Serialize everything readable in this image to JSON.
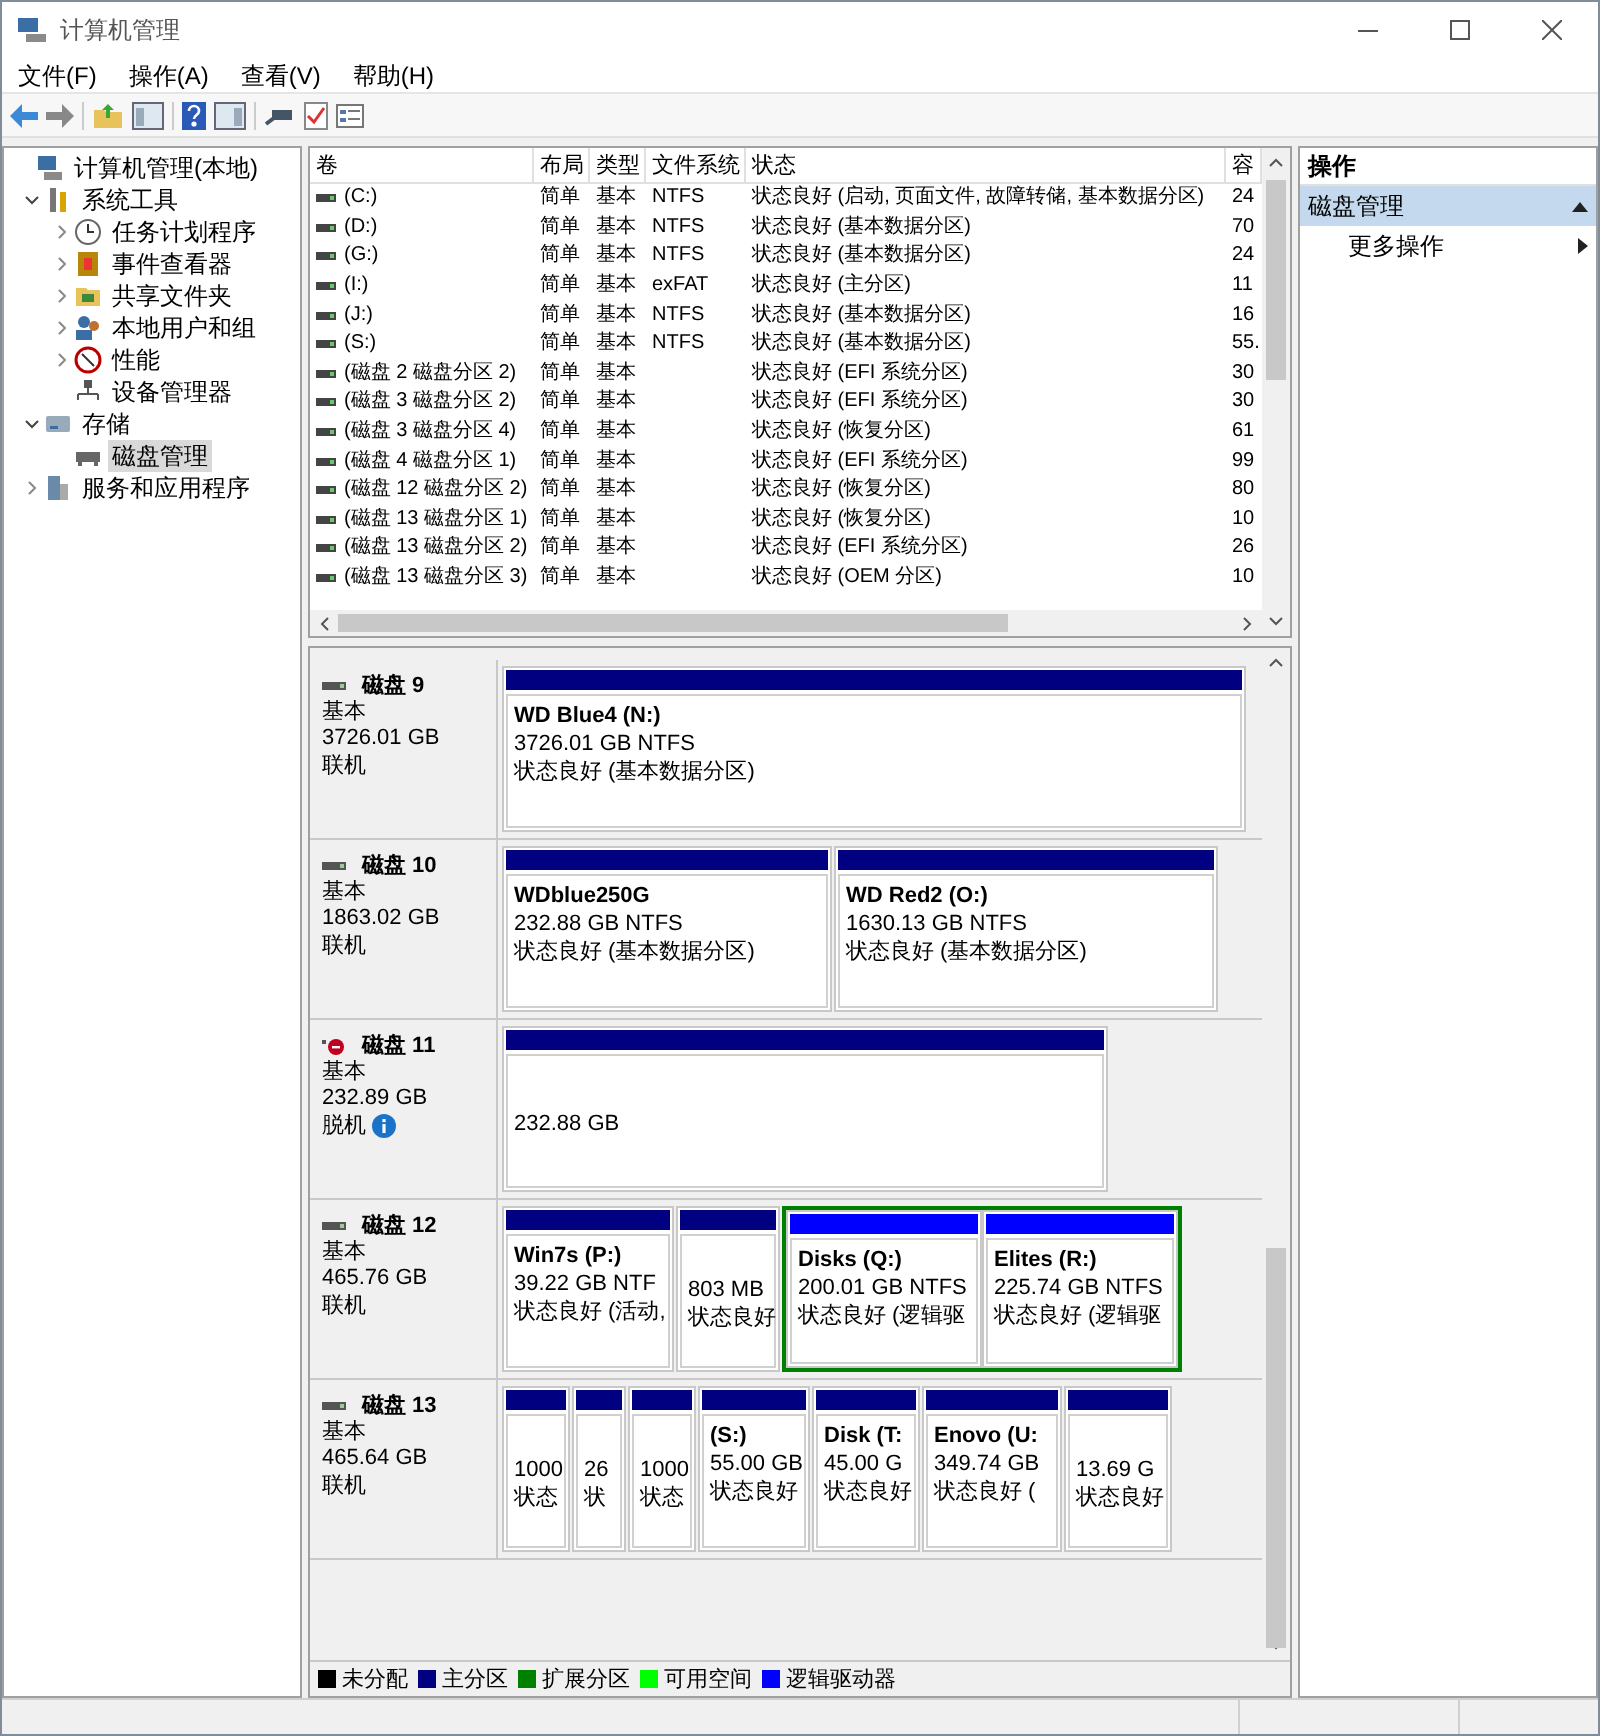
{
  "window": {
    "title": "计算机管理"
  },
  "menu": [
    "文件(F)",
    "操作(A)",
    "查看(V)",
    "帮助(H)"
  ],
  "tree": [
    {
      "label": "计算机管理(本地)",
      "kind": "root",
      "selected": false,
      "children": [
        {
          "label": "系统工具",
          "kind": "folder",
          "expanded": true,
          "selected": false,
          "children": [
            {
              "label": "任务计划程序",
              "kind": "folder",
              "expanded": false,
              "selected": false
            },
            {
              "label": "事件查看器",
              "kind": "folder",
              "expanded": false,
              "selected": false
            },
            {
              "label": "共享文件夹",
              "kind": "folder",
              "expanded": false,
              "selected": false
            },
            {
              "label": "本地用户和组",
              "kind": "folder",
              "expanded": false,
              "selected": false
            },
            {
              "label": "性能",
              "kind": "folder",
              "expanded": false,
              "selected": false
            },
            {
              "label": "设备管理器",
              "kind": "leaf",
              "selected": false
            }
          ]
        },
        {
          "label": "存储",
          "kind": "folder",
          "expanded": true,
          "selected": false,
          "children": [
            {
              "label": "磁盘管理",
              "kind": "leaf",
              "selected": true
            }
          ]
        },
        {
          "label": "服务和应用程序",
          "kind": "folder",
          "expanded": false,
          "selected": false
        }
      ]
    }
  ],
  "volumes": {
    "columns": [
      "卷",
      "布局",
      "类型",
      "文件系统",
      "状态",
      "容"
    ],
    "rows": [
      [
        "(C:)",
        "简单",
        "基本",
        "NTFS",
        "状态良好 (启动, 页面文件, 故障转储, 基本数据分区)",
        "24"
      ],
      [
        "(D:)",
        "简单",
        "基本",
        "NTFS",
        "状态良好 (基本数据分区)",
        "70"
      ],
      [
        "(G:)",
        "简单",
        "基本",
        "NTFS",
        "状态良好 (基本数据分区)",
        "24"
      ],
      [
        "(I:)",
        "简单",
        "基本",
        "exFAT",
        "状态良好 (主分区)",
        "11"
      ],
      [
        "(J:)",
        "简单",
        "基本",
        "NTFS",
        "状态良好 (基本数据分区)",
        "16"
      ],
      [
        "(S:)",
        "简单",
        "基本",
        "NTFS",
        "状态良好 (基本数据分区)",
        "55."
      ],
      [
        "(磁盘 2 磁盘分区 2)",
        "简单",
        "基本",
        "",
        "状态良好 (EFI 系统分区)",
        "30"
      ],
      [
        "(磁盘 3 磁盘分区 2)",
        "简单",
        "基本",
        "",
        "状态良好 (EFI 系统分区)",
        "30"
      ],
      [
        "(磁盘 3 磁盘分区 4)",
        "简单",
        "基本",
        "",
        "状态良好 (恢复分区)",
        "61"
      ],
      [
        "(磁盘 4 磁盘分区 1)",
        "简单",
        "基本",
        "",
        "状态良好 (EFI 系统分区)",
        "99"
      ],
      [
        "(磁盘 12 磁盘分区 2)",
        "简单",
        "基本",
        "",
        "状态良好 (恢复分区)",
        "80"
      ],
      [
        "(磁盘 13 磁盘分区 1)",
        "简单",
        "基本",
        "",
        "状态良好 (恢复分区)",
        "10"
      ],
      [
        "(磁盘 13 磁盘分区 2)",
        "简单",
        "基本",
        "",
        "状态良好 (EFI 系统分区)",
        "26"
      ],
      [
        "(磁盘 13 磁盘分区 3)",
        "简单",
        "基本",
        "",
        "状态良好 (OEM 分区)",
        "10"
      ]
    ]
  },
  "disks": [
    {
      "name": "磁盘 9",
      "type": "基本",
      "size": "3726.01 GB",
      "status": "联机",
      "offline": false,
      "partitions": [
        {
          "kind": "primary",
          "name": "WD Blue4  (N:)",
          "lines": [
            "3726.01 GB NTFS",
            "状态良好 (基本数据分区)"
          ]
        }
      ]
    },
    {
      "name": "磁盘 10",
      "type": "基本",
      "size": "1863.02 GB",
      "status": "联机",
      "offline": false,
      "partitions": [
        {
          "kind": "primary",
          "name": "WDblue250G",
          "lines": [
            "232.88 GB NTFS",
            "状态良好 (基本数据分区)"
          ]
        },
        {
          "kind": "primary",
          "name": "WD Red2  (O:)",
          "lines": [
            "1630.13 GB NTFS",
            "状态良好 (基本数据分区)"
          ]
        }
      ]
    },
    {
      "name": "磁盘 11",
      "type": "基本",
      "size": "232.89 GB",
      "status": "脱机",
      "offline": true,
      "partitions": [
        {
          "kind": "primary",
          "lines": [
            "232.88 GB"
          ]
        }
      ]
    },
    {
      "name": "磁盘 12",
      "type": "基本",
      "size": "465.76 GB",
      "status": "联机",
      "offline": false,
      "partitions": [
        {
          "kind": "primary",
          "name": "Win7s  (P:)",
          "lines": [
            "39.22 GB NTF",
            "状态良好 (活动,"
          ]
        },
        {
          "kind": "primary",
          "lines": [
            "803 MB",
            "状态良好"
          ]
        },
        {
          "kind": "extended",
          "partitions": [
            {
              "kind": "logical",
              "name": "Disks  (Q:)",
              "lines": [
                "200.01 GB NTFS",
                "状态良好 (逻辑驱"
              ]
            },
            {
              "kind": "logical",
              "name": "Elites  (R:)",
              "lines": [
                "225.74 GB NTFS",
                "状态良好 (逻辑驱"
              ]
            }
          ]
        }
      ]
    },
    {
      "name": "磁盘 13",
      "type": "基本",
      "size": "465.64 GB",
      "status": "联机",
      "offline": false,
      "partitions": [
        {
          "kind": "primary",
          "lines": [
            "1000",
            "状态"
          ]
        },
        {
          "kind": "primary",
          "lines": [
            "26",
            "状"
          ]
        },
        {
          "kind": "primary",
          "lines": [
            "1000",
            "状态"
          ]
        },
        {
          "kind": "primary",
          "name": "(S:)",
          "lines": [
            "55.00 GB",
            "状态良好"
          ]
        },
        {
          "kind": "primary",
          "name": "Disk  (T:",
          "lines": [
            "45.00 G",
            "状态良好"
          ]
        },
        {
          "kind": "primary",
          "name": "Enovo  (U:",
          "lines": [
            "349.74 GB",
            "状态良好 ("
          ]
        },
        {
          "kind": "primary",
          "lines": [
            "13.69 G",
            "状态良好"
          ]
        }
      ]
    }
  ],
  "legend": [
    {
      "label": "未分配",
      "color": "#000000"
    },
    {
      "label": "主分区",
      "color": "#000080"
    },
    {
      "label": "扩展分区",
      "color": "#008000"
    },
    {
      "label": "可用空间",
      "color": "#00ff00"
    },
    {
      "label": "逻辑驱动器",
      "color": "#0000ff"
    }
  ],
  "actions": {
    "title": "操作",
    "sections": [
      {
        "label": "磁盘管理",
        "expanded": true,
        "items": [
          "更多操作"
        ]
      }
    ]
  }
}
